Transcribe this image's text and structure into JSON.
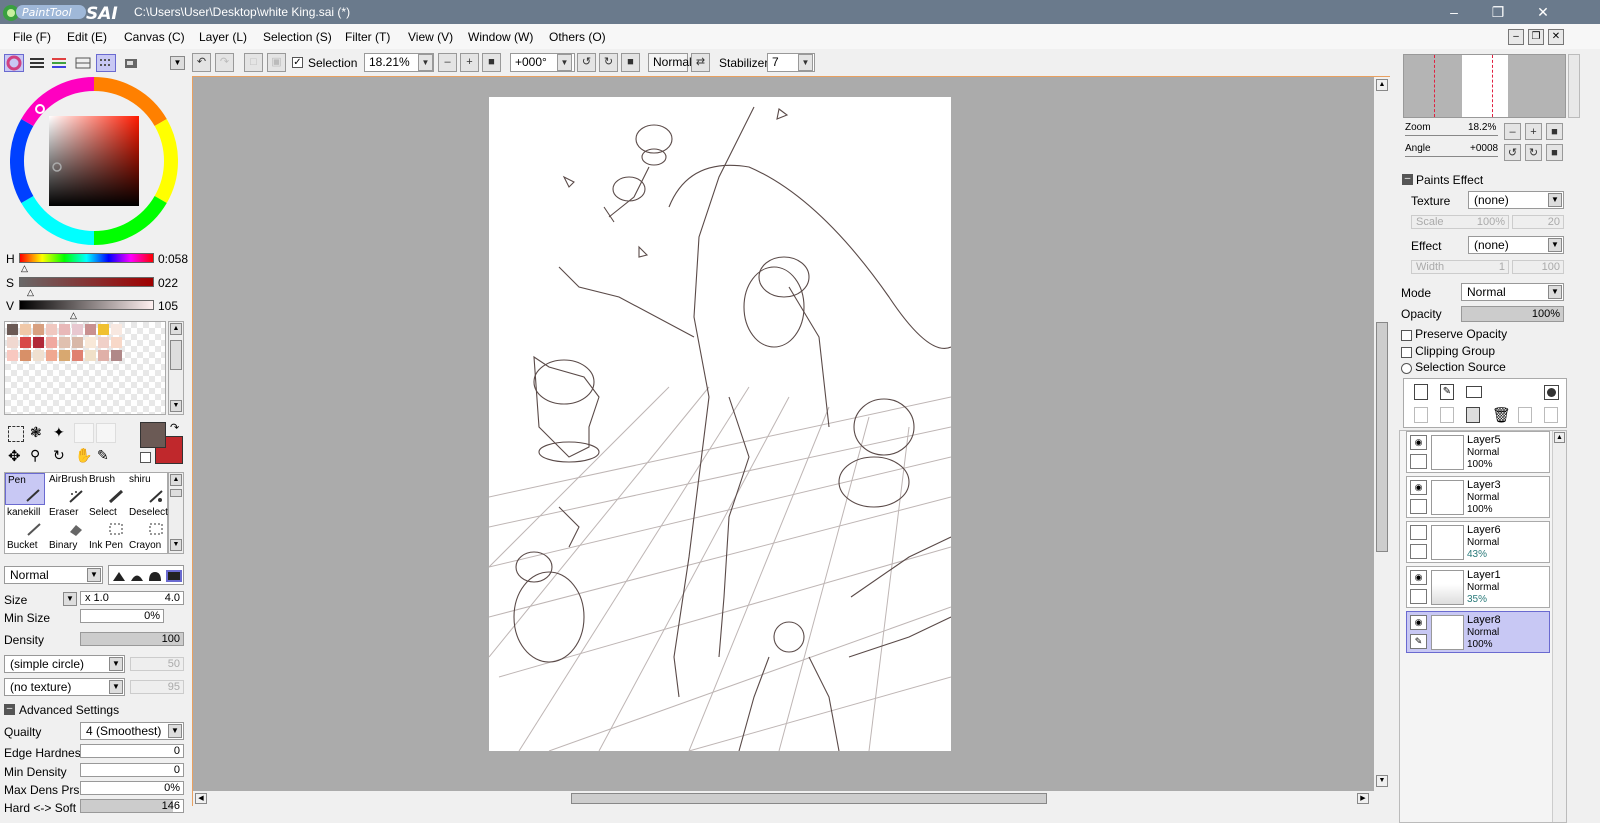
{
  "title": "C:\\Users\\User\\Desktop\\white King.sai (*)",
  "logo_text": "PaintTool SAI",
  "menu": [
    "File (F)",
    "Edit (E)",
    "Canvas (C)",
    "Layer (L)",
    "Selection (S)",
    "Filter (T)",
    "View (V)",
    "Window (W)",
    "Others (O)"
  ],
  "toolbar": {
    "selection_label": "Selection",
    "zoom": "18.21%",
    "angle": "+000°",
    "mode": "Normal",
    "stabilizer_label": "Stabilizer",
    "stabilizer": "7"
  },
  "color": {
    "h_label": "H",
    "h_value": "0:058",
    "s_label": "S",
    "s_value": "022",
    "v_label": "V",
    "v_value": "105",
    "primary": "#6b5a55",
    "secondary": "#c0282c",
    "swatches": [
      "#6b5a55",
      "#f0c8a8",
      "#d8a080",
      "#f0c8c0",
      "#e8b8b8",
      "#e8c8d0",
      "#c89090",
      "#f0c030",
      "#f8e8e0",
      "#f0d8d0",
      "#d84848",
      "#b02838",
      "#f0a8a0",
      "#e0c0b0",
      "#d8b8a8",
      "#f8e8d8",
      "#f0d0c8",
      "#f8d8c8",
      "#f8c8c0",
      "#d89068",
      "#f0e0d0",
      "#f0a890",
      "#d8a870",
      "#e08070",
      "#f0e0c8",
      "#e0b0a8",
      "#b08888"
    ]
  },
  "tools": [
    {
      "name": "Pen"
    },
    {
      "name": "AirBrush"
    },
    {
      "name": "Brush"
    },
    {
      "name": "shiru"
    },
    {
      "name": "kanekill"
    },
    {
      "name": "Eraser"
    },
    {
      "name": "Select"
    },
    {
      "name": "Deselect"
    },
    {
      "name": "Bucket"
    },
    {
      "name": "Binary"
    },
    {
      "name": "Ink Pen"
    },
    {
      "name": "Crayon"
    }
  ],
  "brush": {
    "blend_mode": "Normal",
    "size_label": "Size",
    "size_mult": "x 1.0",
    "size_value": "4.0",
    "min_size_label": "Min Size",
    "min_size_value": "0%",
    "density_label": "Density",
    "density_value": "100",
    "shape": "(simple circle)",
    "shape_value": "50",
    "texture": "(no texture)",
    "texture_value": "95",
    "advanced_label": "Advanced Settings",
    "quality_label": "Quailty",
    "quality_value": "4 (Smoothest)",
    "edge_label": "Edge Hardness",
    "edge_value": "0",
    "min_density_label": "Min Density",
    "min_density_value": "0",
    "max_dens_label": "Max Dens Prs.",
    "max_dens_value": "0%",
    "hard_soft_label": "Hard <-> Soft",
    "hard_soft_value": "146"
  },
  "navigator": {
    "zoom_label": "Zoom",
    "zoom_value": "18.2%",
    "angle_label": "Angle",
    "angle_value": "+0008"
  },
  "paints_effect": {
    "header": "Paints Effect",
    "texture_label": "Texture",
    "texture_value": "(none)",
    "scale_label": "Scale",
    "scale_value": "100%",
    "scale_num": "20",
    "effect_label": "Effect",
    "effect_value": "(none)",
    "width_label": "Width",
    "width_value": "1",
    "width_num": "100"
  },
  "layer_props": {
    "mode_label": "Mode",
    "mode_value": "Normal",
    "opacity_label": "Opacity",
    "opacity_value": "100%",
    "preserve_opacity": "Preserve Opacity",
    "clipping_group": "Clipping Group",
    "selection_source": "Selection Source"
  },
  "layers": [
    {
      "name": "Layer5",
      "mode": "Normal",
      "opacity": "100%",
      "visible": true,
      "selected": false
    },
    {
      "name": "Layer3",
      "mode": "Normal",
      "opacity": "100%",
      "visible": true,
      "selected": false
    },
    {
      "name": "Layer6",
      "mode": "Normal",
      "opacity": "43%",
      "visible": false,
      "selected": false
    },
    {
      "name": "Layer1",
      "mode": "Normal",
      "opacity": "35%",
      "visible": true,
      "selected": false
    },
    {
      "name": "Layer8",
      "mode": "Normal",
      "opacity": "100%",
      "visible": true,
      "selected": true
    }
  ]
}
